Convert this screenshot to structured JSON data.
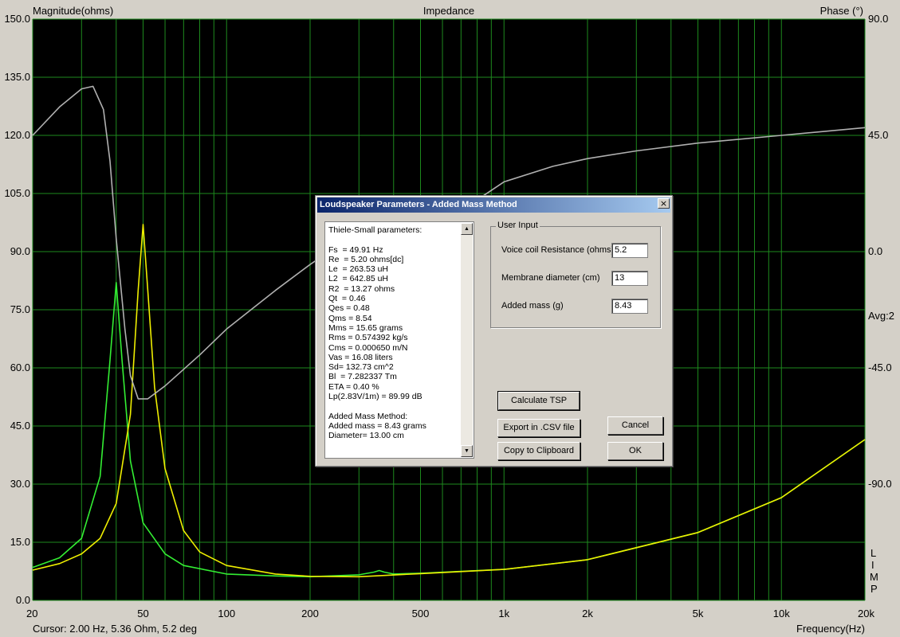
{
  "chart_data": {
    "type": "line",
    "title": "Impedance",
    "xlabel": "Frequency(Hz)",
    "ylabel": "Magnitude(ohms)",
    "y2label": "Phase (°)",
    "x_scale": "log",
    "xlim": [
      20,
      20000
    ],
    "ylim": [
      0,
      150
    ],
    "y2lim": [
      -135,
      90
    ],
    "grid": true,
    "background": "#000000",
    "x_ticks": [
      "20",
      "50",
      "100",
      "200",
      "500",
      "1k",
      "2k",
      "5k",
      "10k",
      "20k"
    ],
    "x_tick_values": [
      20,
      50,
      100,
      200,
      500,
      1000,
      2000,
      5000,
      10000,
      20000
    ],
    "y_ticks": [
      "0.0",
      "15.0",
      "30.0",
      "45.0",
      "60.0",
      "75.0",
      "90.0",
      "105.0",
      "120.0",
      "135.0",
      "150.0"
    ],
    "y2_ticks": [
      "90.0",
      "45.0",
      "0.0",
      "-45.0",
      "-90.0"
    ],
    "y2_tick_values": [
      90,
      45,
      0,
      -45,
      -90
    ],
    "series": [
      {
        "color": "#33ee33",
        "axis": "y",
        "x": [
          20,
          25,
          30,
          35,
          38,
          40,
          42,
          45,
          50,
          60,
          70,
          100,
          150,
          200,
          300,
          340,
          355,
          370,
          400,
          500,
          1000,
          2000,
          5000,
          10000,
          20000
        ],
        "y": [
          8.5,
          11,
          16,
          32,
          62,
          82,
          62,
          36,
          20,
          12,
          9,
          6.8,
          6.3,
          6.1,
          6.6,
          7.3,
          7.7,
          7.3,
          6.8,
          7.0,
          8.0,
          10.5,
          17.5,
          26.5,
          41.5
        ]
      },
      {
        "color": "#eeee00",
        "axis": "y",
        "x": [
          20,
          25,
          30,
          35,
          40,
          45,
          48,
          50,
          52,
          55,
          60,
          70,
          80,
          100,
          150,
          200,
          300,
          500,
          1000,
          2000,
          5000,
          10000,
          20000
        ],
        "y": [
          7.8,
          9.5,
          12,
          16,
          25,
          48,
          80,
          97,
          80,
          55,
          34,
          18,
          12.5,
          9,
          6.8,
          6.2,
          6.1,
          6.9,
          8.0,
          10.5,
          17.5,
          26.5,
          41.5
        ]
      },
      {
        "color": "#b0b0b0",
        "axis": "y2",
        "x": [
          20,
          25,
          30,
          33,
          36,
          38,
          40,
          43,
          45,
          48,
          52,
          60,
          80,
          100,
          150,
          200,
          300,
          320,
          340,
          360,
          400,
          450,
          500,
          600,
          700,
          800,
          1000,
          1500,
          2000,
          3000,
          5000,
          10000,
          20000
        ],
        "y": [
          45,
          56,
          63,
          64,
          55,
          35,
          5,
          -30,
          -48,
          -57,
          -57,
          -52,
          -40,
          -30,
          -15,
          -5,
          8,
          9,
          3,
          -2,
          1,
          10,
          18,
          18,
          20,
          20,
          27,
          33,
          36,
          39,
          42,
          45,
          48
        ]
      }
    ],
    "right_labels": [
      "Avg:2",
      "L",
      "I",
      "M",
      "P"
    ]
  },
  "status": {
    "cursor": "Cursor: 2.00 Hz, 5.36 Ohm, 5.2 deg"
  },
  "dialog": {
    "title": "Loudspeaker Parameters - Added Mass Method",
    "close": "×",
    "tsp_text": "Thiele-Small parameters:\n\nFs  = 49.91 Hz\nRe  = 5.20 ohms[dc]\nLe  = 263.53 uH\nL2  = 642.85 uH\nR2  = 13.27 ohms\nQt  = 0.46\nQes = 0.48\nQms = 8.54\nMms = 15.65 grams\nRms = 0.574392 kg/s\nCms = 0.000650 m/N\nVas = 16.08 liters\nSd= 132.73 cm^2\nBl  = 7.282337 Tm\nETA = 0.40 %\nLp(2.83V/1m) = 89.99 dB\n\nAdded Mass Method:\nAdded mass = 8.43 grams\nDiameter= 13.00 cm",
    "group_title": "User Input",
    "fields": [
      {
        "label": "Voice coil Resistance (ohms)",
        "value": "5.2"
      },
      {
        "label": "Membrane diameter (cm)",
        "value": "13"
      },
      {
        "label": "Added mass (g)",
        "value": "8.43"
      }
    ],
    "buttons": {
      "calc": "Calculate TSP",
      "export": "Export in .CSV file",
      "copy": "Copy to Clipboard",
      "cancel": "Cancel",
      "ok": "OK"
    }
  }
}
